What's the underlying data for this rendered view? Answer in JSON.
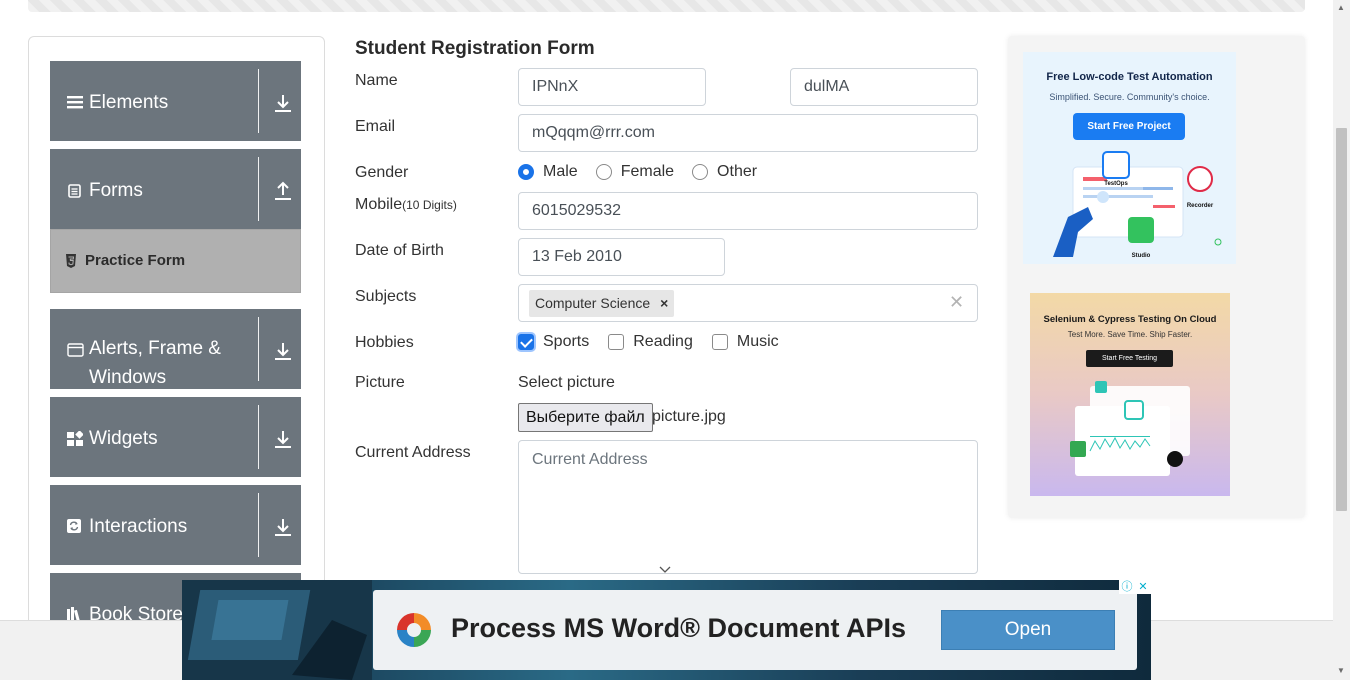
{
  "sidebar": {
    "groups": [
      {
        "label": "Elements",
        "icon": "hamburger-icon",
        "arrow": "download-arrow-icon"
      },
      {
        "label": "Forms",
        "icon": "document-icon",
        "arrow": "upload-arrow-icon"
      },
      {
        "label": "Alerts, Frame & Windows",
        "icon": "window-icon",
        "arrow": "download-arrow-icon"
      },
      {
        "label": "Widgets",
        "icon": "widgets-icon",
        "arrow": "download-arrow-icon"
      },
      {
        "label": "Interactions",
        "icon": "interactions-icon",
        "arrow": "download-arrow-icon"
      },
      {
        "label": "Book Store",
        "icon": "book-icon",
        "arrow": "download-arrow-icon"
      }
    ],
    "active_item": "Practice Form"
  },
  "form": {
    "title": "Student Registration Form",
    "labels": {
      "name": "Name",
      "email": "Email",
      "gender": "Gender",
      "mobile": "Mobile",
      "mobile_hint": "(10 Digits)",
      "dob": "Date of Birth",
      "subjects": "Subjects",
      "hobbies": "Hobbies",
      "picture": "Picture",
      "address": "Current Address"
    },
    "first_name": "IPNnX",
    "last_name": "dulMA",
    "email": "mQqqm@rrr.com",
    "gender_options": [
      "Male",
      "Female",
      "Other"
    ],
    "gender_selected": "Male",
    "mobile": "6015029532",
    "dob": "13 Feb 2010",
    "subjects": [
      "Computer Science"
    ],
    "hobbies": [
      {
        "label": "Sports",
        "checked": true
      },
      {
        "label": "Reading",
        "checked": false
      },
      {
        "label": "Music",
        "checked": false
      }
    ],
    "picture_prompt": "Select picture",
    "file_button": "Выберите файл",
    "file_name": "picture.jpg",
    "address_placeholder": "Current Address"
  },
  "ads": {
    "ad1": {
      "title": "Free Low-code Test Automation",
      "subtitle": "Simplified. Secure. Community's choice.",
      "button": "Start Free Project",
      "labels": [
        "TestOps",
        "Recorder",
        "Studio"
      ]
    },
    "ad2": {
      "title": "Selenium & Cypress Testing On Cloud",
      "subtitle": "Test More. Save Time. Ship Faster.",
      "button": "Start Free Testing"
    },
    "banner": {
      "text": "Process MS Word® Document APIs",
      "button": "Open"
    }
  },
  "colors": {
    "sidebar_group": "#6c757d",
    "sidebar_active": "#b0b0b0",
    "accent": "#1a73e8"
  }
}
